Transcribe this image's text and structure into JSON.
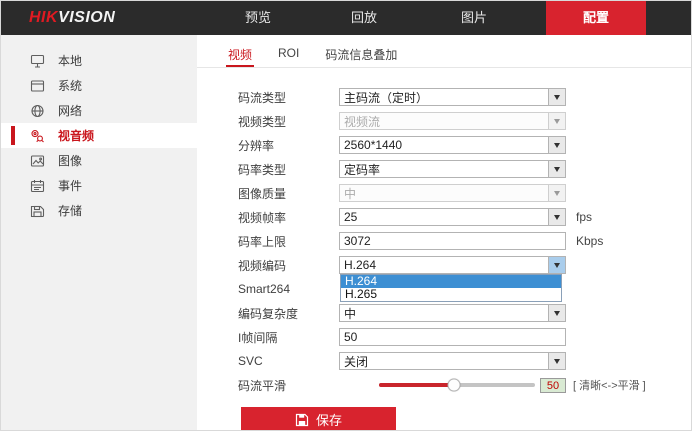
{
  "topbar": {
    "logo": {
      "red": "HIK",
      "white": "VISION"
    },
    "nav": {
      "preview": "预览",
      "playback": "回放",
      "picture": "图片",
      "config": "配置"
    }
  },
  "sidebar": {
    "items": [
      {
        "label": "本地",
        "icon": "monitor-icon",
        "active": false
      },
      {
        "label": "系统",
        "icon": "system-icon",
        "active": false
      },
      {
        "label": "网络",
        "icon": "network-icon",
        "active": false
      },
      {
        "label": "视音频",
        "icon": "audio-video-icon",
        "active": true
      },
      {
        "label": "图像",
        "icon": "image-icon",
        "active": false
      },
      {
        "label": "事件",
        "icon": "event-icon",
        "active": false
      },
      {
        "label": "存储",
        "icon": "storage-icon",
        "active": false
      }
    ]
  },
  "tabs": {
    "video": "视频",
    "roi": "ROI",
    "overlay": "码流信息叠加"
  },
  "form": {
    "rows": [
      {
        "label": "码流类型",
        "value": "主码流（定时）",
        "type": "select"
      },
      {
        "label": "视频类型",
        "value": "视频流",
        "type": "select",
        "disabled": true
      },
      {
        "label": "分辨率",
        "value": "2560*1440",
        "type": "select"
      },
      {
        "label": "码率类型",
        "value": "定码率",
        "type": "select"
      },
      {
        "label": "图像质量",
        "value": "中",
        "type": "select",
        "disabled": true
      },
      {
        "label": "视频帧率",
        "value": "25",
        "type": "select",
        "unit": "fps"
      },
      {
        "label": "码率上限",
        "value": "3072",
        "type": "input",
        "unit": "Kbps"
      },
      {
        "label": "视频编码",
        "value": "H.264",
        "type": "select",
        "open": true,
        "options": [
          "H.264",
          "H.265"
        ],
        "highlighted_option": "H.264"
      },
      {
        "label": "Smart264"
      },
      {
        "label": "编码复杂度",
        "value": "中",
        "type": "select"
      },
      {
        "label": "I帧间隔",
        "value": "50",
        "type": "input"
      },
      {
        "label": "SVC",
        "value": "关闭",
        "type": "select"
      },
      {
        "label": "码流平滑",
        "type": "slider",
        "value": "50",
        "percent": 48,
        "hint": "[ 清晰<->平滑 ]"
      }
    ]
  },
  "save": {
    "label": "保存"
  },
  "colors": {
    "accent_red": "#d8232e",
    "active_red": "#c9161d",
    "dropdown_highlight": "#3d8fd3",
    "topbar_bg": "#2b2b2b",
    "slider_value_bg": "#d9ead3"
  }
}
